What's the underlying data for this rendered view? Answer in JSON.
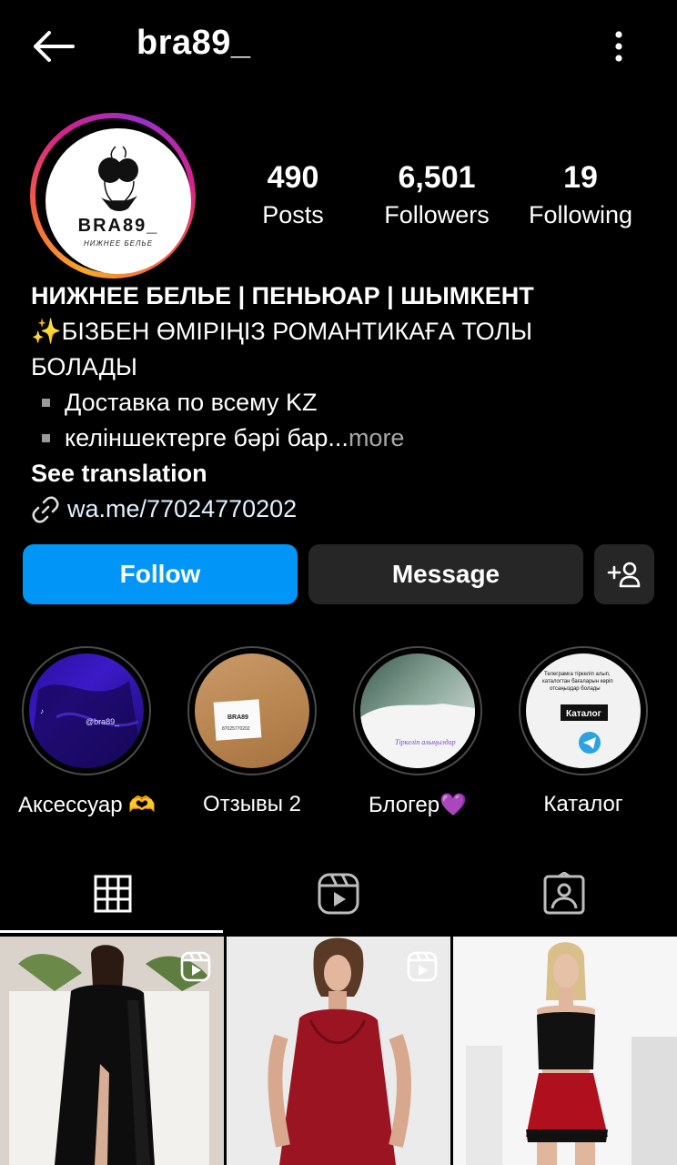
{
  "header": {
    "username": "bra89_",
    "back_icon": "arrow-left-icon",
    "menu_icon": "more-vertical-icon"
  },
  "profile": {
    "avatar_logo": "BRA89_",
    "avatar_subtitle": "НИЖНЕЕ БЕЛЬЕ",
    "stats": [
      {
        "value": "490",
        "label": "Posts"
      },
      {
        "value": "6,501",
        "label": "Followers"
      },
      {
        "value": "19",
        "label": "Following"
      }
    ]
  },
  "bio": {
    "title": "НИЖНЕЕ БЕЛЬЕ | ПЕНЬЮАР | ШЫМКЕНТ",
    "line1": "✨БІЗБЕН ӨМІРІҢІЗ РОМАНТИКАҒА ТОЛЫ",
    "line2": "БОЛАДЫ",
    "bullet1": "Доставка по всему KZ",
    "bullet2": "келіншектерге бәрі бар...",
    "more": " more",
    "see_translation": "See translation",
    "link": "wa.me/77024770202"
  },
  "actions": {
    "follow": "Follow",
    "message": "Message",
    "add_icon": "add-person-icon"
  },
  "highlights": [
    {
      "label": "Аксессуар 🫶"
    },
    {
      "label": "Отзывы 2"
    },
    {
      "label": "Блогер💜"
    },
    {
      "label": "Каталог"
    }
  ],
  "tabs": [
    "grid-icon",
    "reels-icon",
    "tagged-icon"
  ],
  "posts": [
    {
      "type": "reel",
      "description": "black robe"
    },
    {
      "type": "reel",
      "description": "red nightgown"
    },
    {
      "type": "photo",
      "description": "black top red shorts"
    }
  ],
  "colors": {
    "accent": "#0095f6",
    "button_dark": "#262626",
    "background": "#000000"
  }
}
